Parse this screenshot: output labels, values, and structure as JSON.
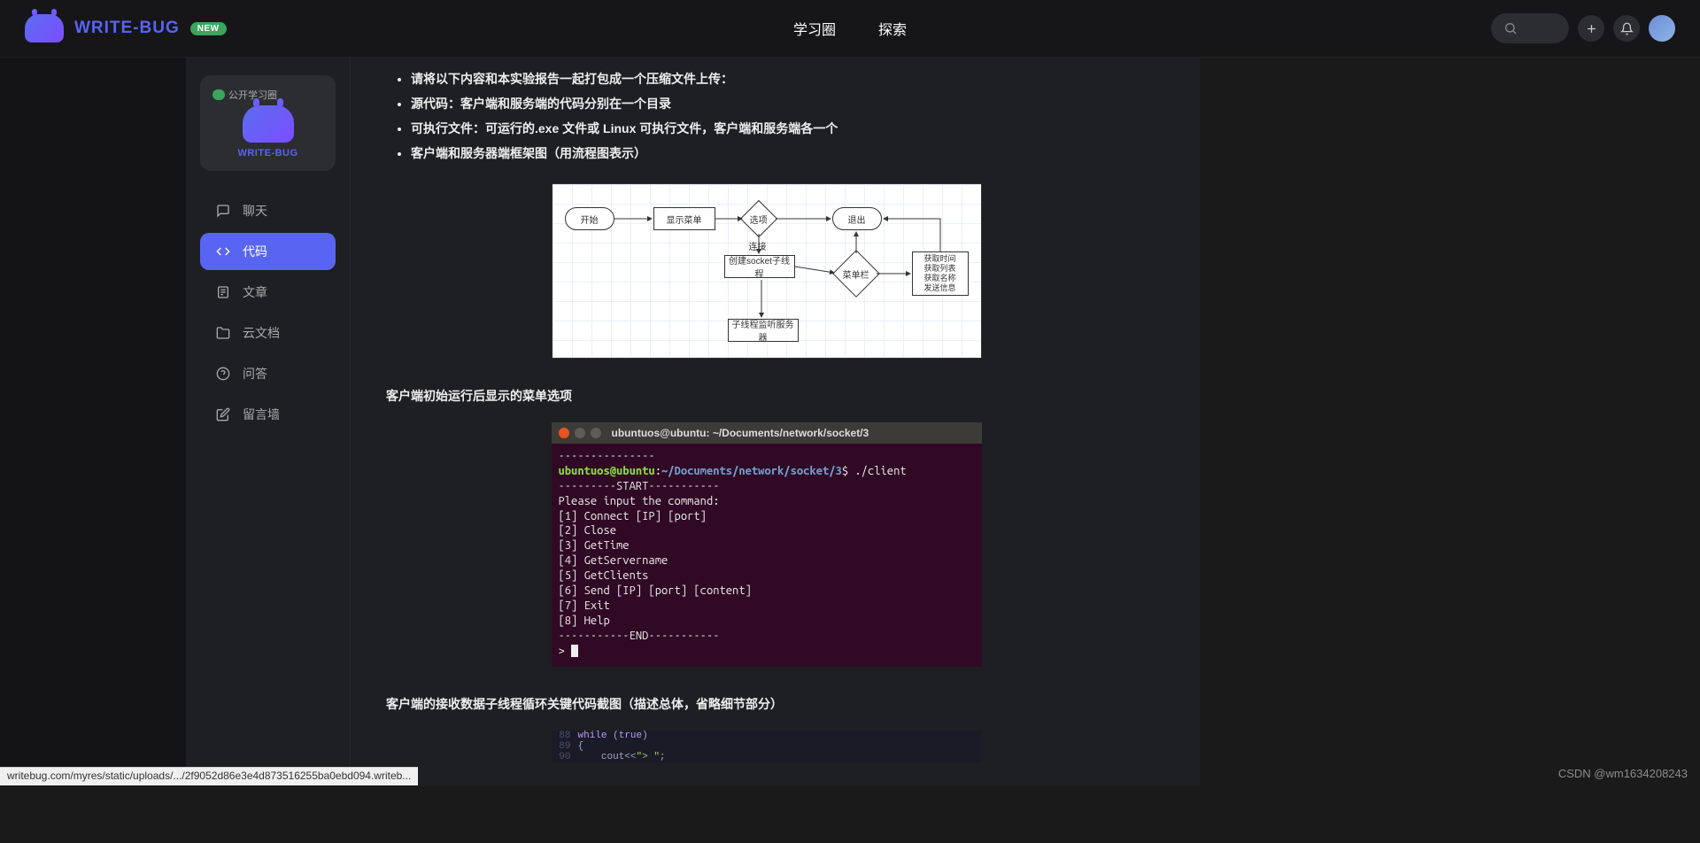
{
  "header": {
    "brand": "WRITE-BUG",
    "badge": "NEW",
    "nav": {
      "study": "学习圈",
      "explore": "探索"
    }
  },
  "sidebar": {
    "card": {
      "badge": "公开学习圈",
      "brand": "WRITE-BUG"
    },
    "items": [
      {
        "label": "聊天"
      },
      {
        "label": "代码"
      },
      {
        "label": "文章"
      },
      {
        "label": "云文档"
      },
      {
        "label": "问答"
      },
      {
        "label": "留言墙"
      }
    ]
  },
  "article": {
    "bullets": [
      "请将以下内容和本实验报告一起打包成一个压缩文件上传：",
      "源代码：客户端和服务端的代码分别在一个目录",
      "可执行文件：可运行的.exe 文件或 Linux 可执行文件，客户端和服务端各一个",
      "客户端和服务器端框架图（用流程图表示）"
    ],
    "h_menu": "客户端初始运行后显示的菜单选项",
    "h_code": "客户端的接收数据子线程循环关键代码截图（描述总体，省略细节部分）"
  },
  "flowchart": {
    "start": "开始",
    "show_menu": "显示菜单",
    "option": "选项",
    "exit": "退出",
    "connect": "连接",
    "create_sock": "创建socket子线程",
    "menu_bar": "菜单栏",
    "actions": "获取时间\n获取列表\n获取名称\n发送信息",
    "listen": "子线程监听服务器"
  },
  "terminal": {
    "title": "ubuntuos@ubuntu: ~/Documents/network/socket/3",
    "user": "ubuntuos@ubuntu",
    "path": "~/Documents/network/socket/3",
    "cmd": "./client",
    "dots1": "-----------",
    "dots2": "----",
    "lines": [
      "---------START-----------",
      "Please input the command:",
      "[1] Connect [IP] [port]",
      "[2] Close",
      "[3] GetTime",
      "[4] GetServername",
      "[5] GetClients",
      "[6] Send [IP] [port] [content]",
      "[7] Exit",
      "[8] Help",
      "-----------END-----------"
    ],
    "prompt2": "> "
  },
  "code": {
    "l88": {
      "n": "88",
      "t": "while (true)"
    },
    "l89": {
      "n": "89",
      "t": "{"
    },
    "l90": {
      "n": "90",
      "t": "    cout<<\"> \";"
    }
  },
  "status_url": "writebug.com/myres/static/uploads/.../2f9052d86e3e4d873516255ba0ebd094.writeb...",
  "watermark": "CSDN @wm1634208243"
}
